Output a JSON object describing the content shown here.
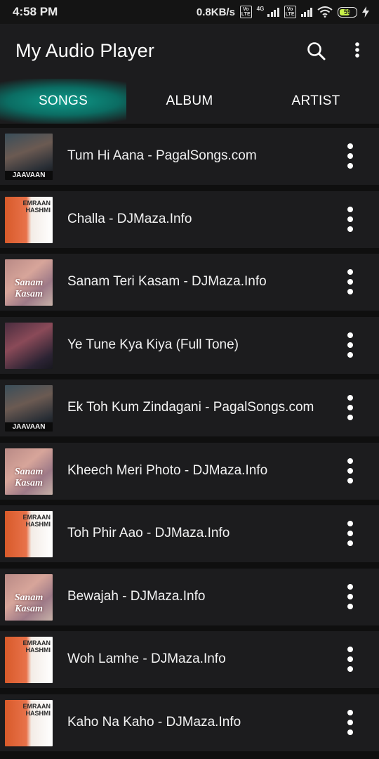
{
  "status_bar": {
    "time": "4:58 PM",
    "net_speed": "0.8KB/s",
    "network_type": "4G",
    "battery_level": "59",
    "battery_color": "#c8f14a"
  },
  "app_bar": {
    "title": "My Audio Player",
    "search_icon": "search-icon",
    "more_icon": "more-vert-icon"
  },
  "tabs": [
    {
      "label": "SONGS",
      "active": true
    },
    {
      "label": "ALBUM",
      "active": false
    },
    {
      "label": "ARTIST",
      "active": false
    }
  ],
  "accent_color": "#0f9a8a",
  "songs": [
    {
      "title": "Tum Hi Aana - PagalSongs.com",
      "art_label": "JAAVAAN"
    },
    {
      "title": "Challa - DJMaza.Info",
      "art_label": "EMRAAN HASHMI"
    },
    {
      "title": "Sanam Teri Kasam - DJMaza.Info",
      "art_label": "Sanam Kasam"
    },
    {
      "title": "Ye Tune Kya Kiya (Full Tone)",
      "art_label": ""
    },
    {
      "title": "Ek Toh Kum Zindagani - PagalSongs.com",
      "art_label": "JAAVAAN"
    },
    {
      "title": "Kheech Meri Photo - DJMaza.Info",
      "art_label": "Sanam Kasam"
    },
    {
      "title": "Toh Phir Aao - DJMaza.Info",
      "art_label": "EMRAAN HASHMI"
    },
    {
      "title": "Bewajah - DJMaza.Info",
      "art_label": "Sanam Kasam"
    },
    {
      "title": "Woh Lamhe - DJMaza.Info",
      "art_label": "EMRAAN HASHMI"
    },
    {
      "title": "Kaho Na Kaho - DJMaza.Info",
      "art_label": "EMRAAN HASHMI"
    }
  ]
}
